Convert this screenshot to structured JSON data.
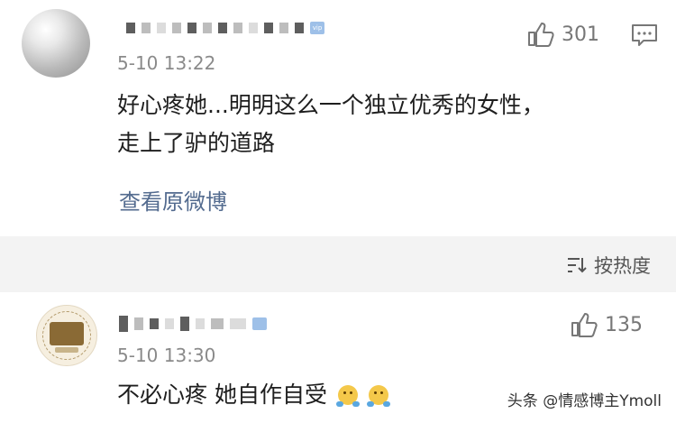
{
  "comment1": {
    "time": "5-10 13:22",
    "likes": "301",
    "text_line1": "好心疼她...明明这么一个独立优秀的女性，",
    "text_line2": "走上了驴的道路",
    "view_link": "查看原微博",
    "badge": "vip"
  },
  "sortbar": {
    "label": "按热度"
  },
  "comment2": {
    "time": "5-10 13:30",
    "likes": "135",
    "text": "不必心疼 她自作自受"
  },
  "watermark": "头条 @情感博主Ymoll",
  "icons": {
    "like": "thumbs-up-icon",
    "comment": "comment-icon",
    "sort": "sort-icon",
    "emoji": "facepalm-emoji-icon"
  },
  "colors": {
    "link": "#536b8f",
    "sortbar_bg": "#f3f3f3",
    "badge": "#9ec0e8"
  }
}
